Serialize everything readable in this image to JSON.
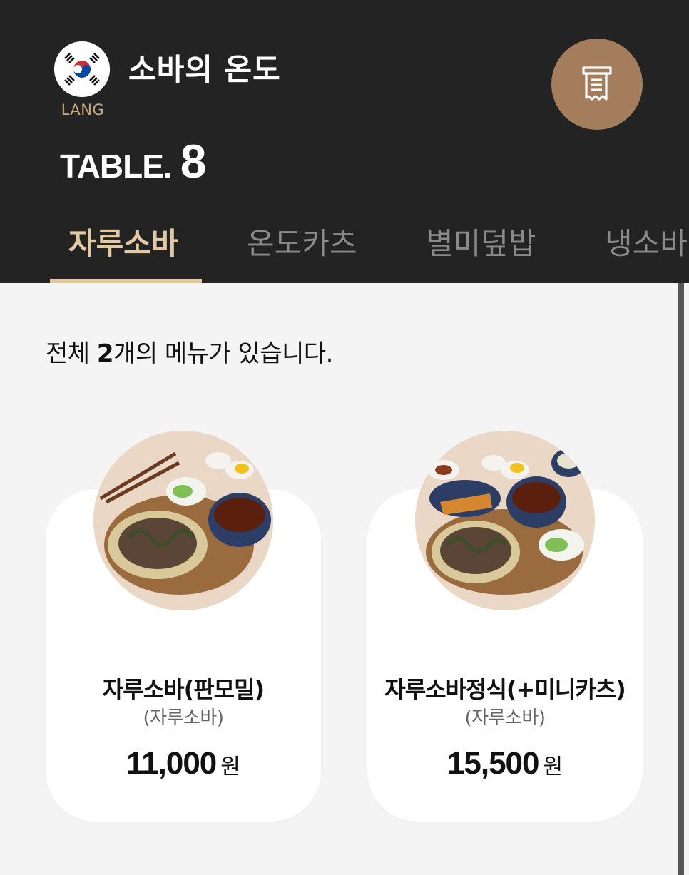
{
  "header": {
    "lang_label": "LANG",
    "store_name": "소바의 온도",
    "table_label": "TABLE.",
    "table_number": "8"
  },
  "tabs": [
    {
      "label": "자루소바",
      "active": true
    },
    {
      "label": "온도카츠",
      "active": false
    },
    {
      "label": "별미덮밥",
      "active": false
    },
    {
      "label": "냉소바",
      "active": false
    }
  ],
  "summary": {
    "prefix": "전체 ",
    "count": "2",
    "suffix": "개의 메뉴가 있습니다."
  },
  "menu_items": [
    {
      "name": "자루소바(판모밀)",
      "category": "(자루소바)",
      "price": "11,000",
      "unit": "원"
    },
    {
      "name": "자루소바정식(+미니카츠)",
      "category": "(자루소바)",
      "price": "15,500",
      "unit": "원"
    }
  ],
  "colors": {
    "header_bg": "#232323",
    "accent_tab": "#e3c9a2",
    "bill_button": "#a37d5c",
    "lang_label": "#c8a97e",
    "page_bg": "#f4f4f4"
  },
  "icons": {
    "language": "korea-flag-icon",
    "bill": "receipt-icon"
  }
}
